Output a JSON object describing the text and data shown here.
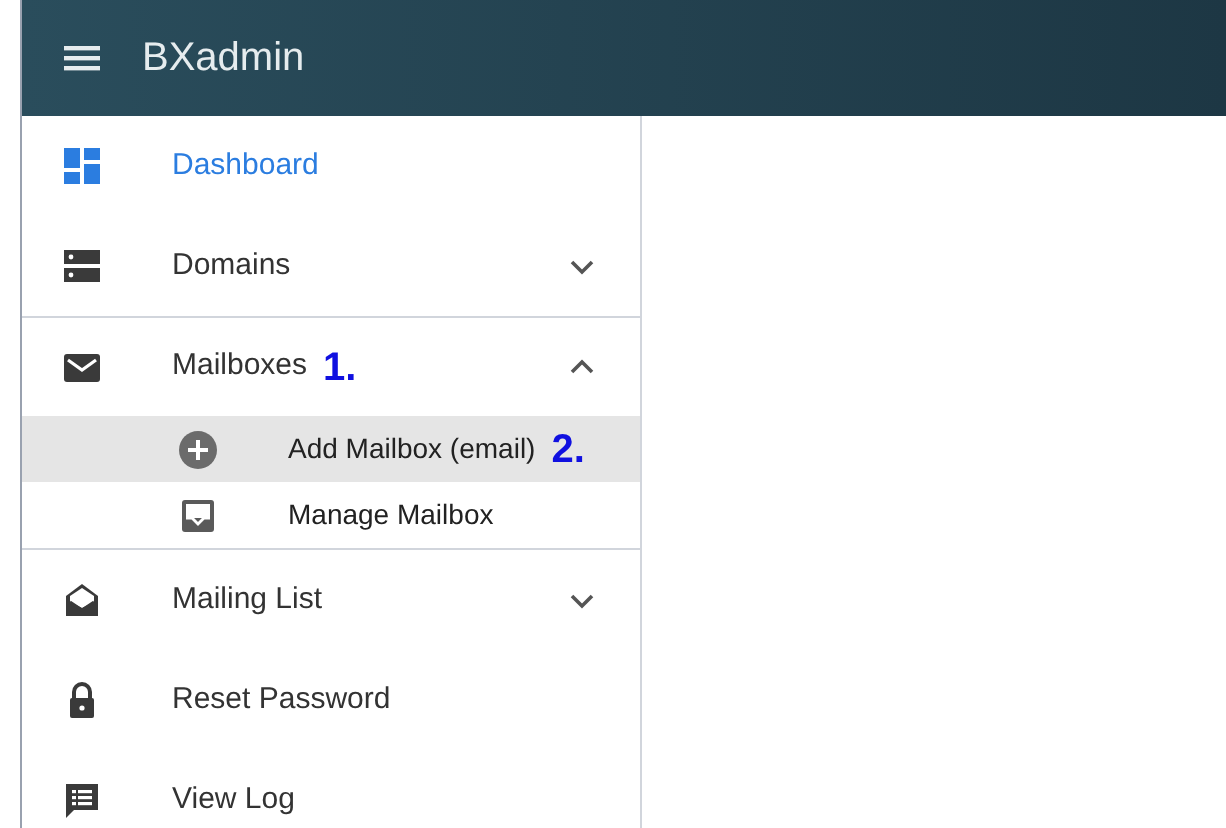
{
  "header": {
    "title": "BXadmin"
  },
  "sidebar": {
    "items": [
      {
        "label": "Dashboard",
        "selected": true
      },
      {
        "label": "Domains",
        "selected": false,
        "expanded": false
      },
      {
        "label": "Mailboxes",
        "selected": false,
        "expanded": true,
        "annotation": "1.",
        "children": [
          {
            "label": "Add Mailbox (email)",
            "selected": true,
            "annotation": "2."
          },
          {
            "label": "Manage Mailbox",
            "selected": false
          }
        ]
      },
      {
        "label": "Mailing List",
        "selected": false,
        "expanded": false
      },
      {
        "label": "Reset Password",
        "selected": false
      },
      {
        "label": "View Log",
        "selected": false
      }
    ]
  }
}
